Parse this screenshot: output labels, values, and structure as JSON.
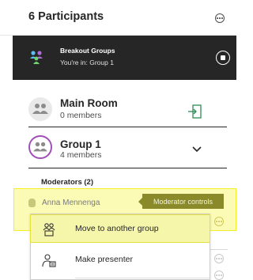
{
  "header": {
    "title": "6 Participants",
    "more_icon": "more-options-icon"
  },
  "breakout": {
    "title": "Breakout Groups",
    "subtitle": "You're in: Group 1",
    "icon": "breakout-groups-icon",
    "action_icon": "stop-icon"
  },
  "groups": [
    {
      "name": "Main Room",
      "count": "0 members",
      "action_icon": "join-room-icon"
    },
    {
      "name": "Group 1",
      "count": "4 members",
      "action_icon": "chevron-down-icon"
    }
  ],
  "moderators_label": "Moderators (2)",
  "participant": {
    "name": "Anna Mennenga"
  },
  "tooltip": {
    "text": "Moderator controls"
  },
  "menu": {
    "items": [
      {
        "label": "Move to another group",
        "icon": "move-group-icon"
      },
      {
        "label": "Make presenter",
        "icon": "presenter-icon"
      }
    ]
  },
  "colors": {
    "accent_purple": "#9f4fb7",
    "highlight_yellow": "#fbfbb5",
    "tooltip_olive": "#8a8a2a",
    "dark_banner": "#262626"
  }
}
